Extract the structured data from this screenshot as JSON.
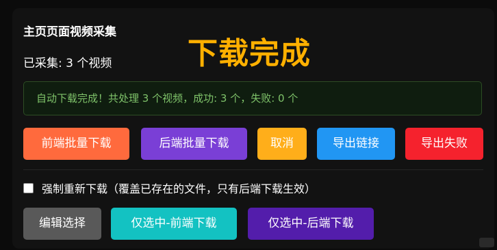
{
  "panel": {
    "title": "主页页面视频采集",
    "status_big": "下载完成",
    "collected": "已采集: 3 个视频",
    "alert": "自动下载完成！共处理 3 个视频，成功: 3 个，失败: 0 个"
  },
  "buttons": {
    "frontend_batch": "前端批量下载",
    "backend_batch": "后端批量下载",
    "cancel": "取消",
    "export_links": "导出链接",
    "export_failed": "导出失败",
    "edit_selection": "编辑选择",
    "only_selected_frontend": "仅选中-前端下载",
    "only_selected_backend": "仅选中-后端下载"
  },
  "options": {
    "force_redownload_label": "强制重新下载（覆盖已存在的文件，只有后端下载生效）",
    "force_redownload_checked": false
  },
  "colors": {
    "accent_title": "#ffb000",
    "frontend_batch": "#ff6a3d",
    "backend_batch": "#7a3fd6",
    "cancel": "#ffae1a",
    "export_links": "#2196f3",
    "export_failed": "#f5222d",
    "edit_selection": "#595959",
    "only_selected_frontend": "#13c2c2",
    "only_selected_backend": "#531dab",
    "alert_text": "#7fc36a"
  },
  "icons": {
    "background_camera": "camera-icon",
    "background_user": "user-icon"
  }
}
